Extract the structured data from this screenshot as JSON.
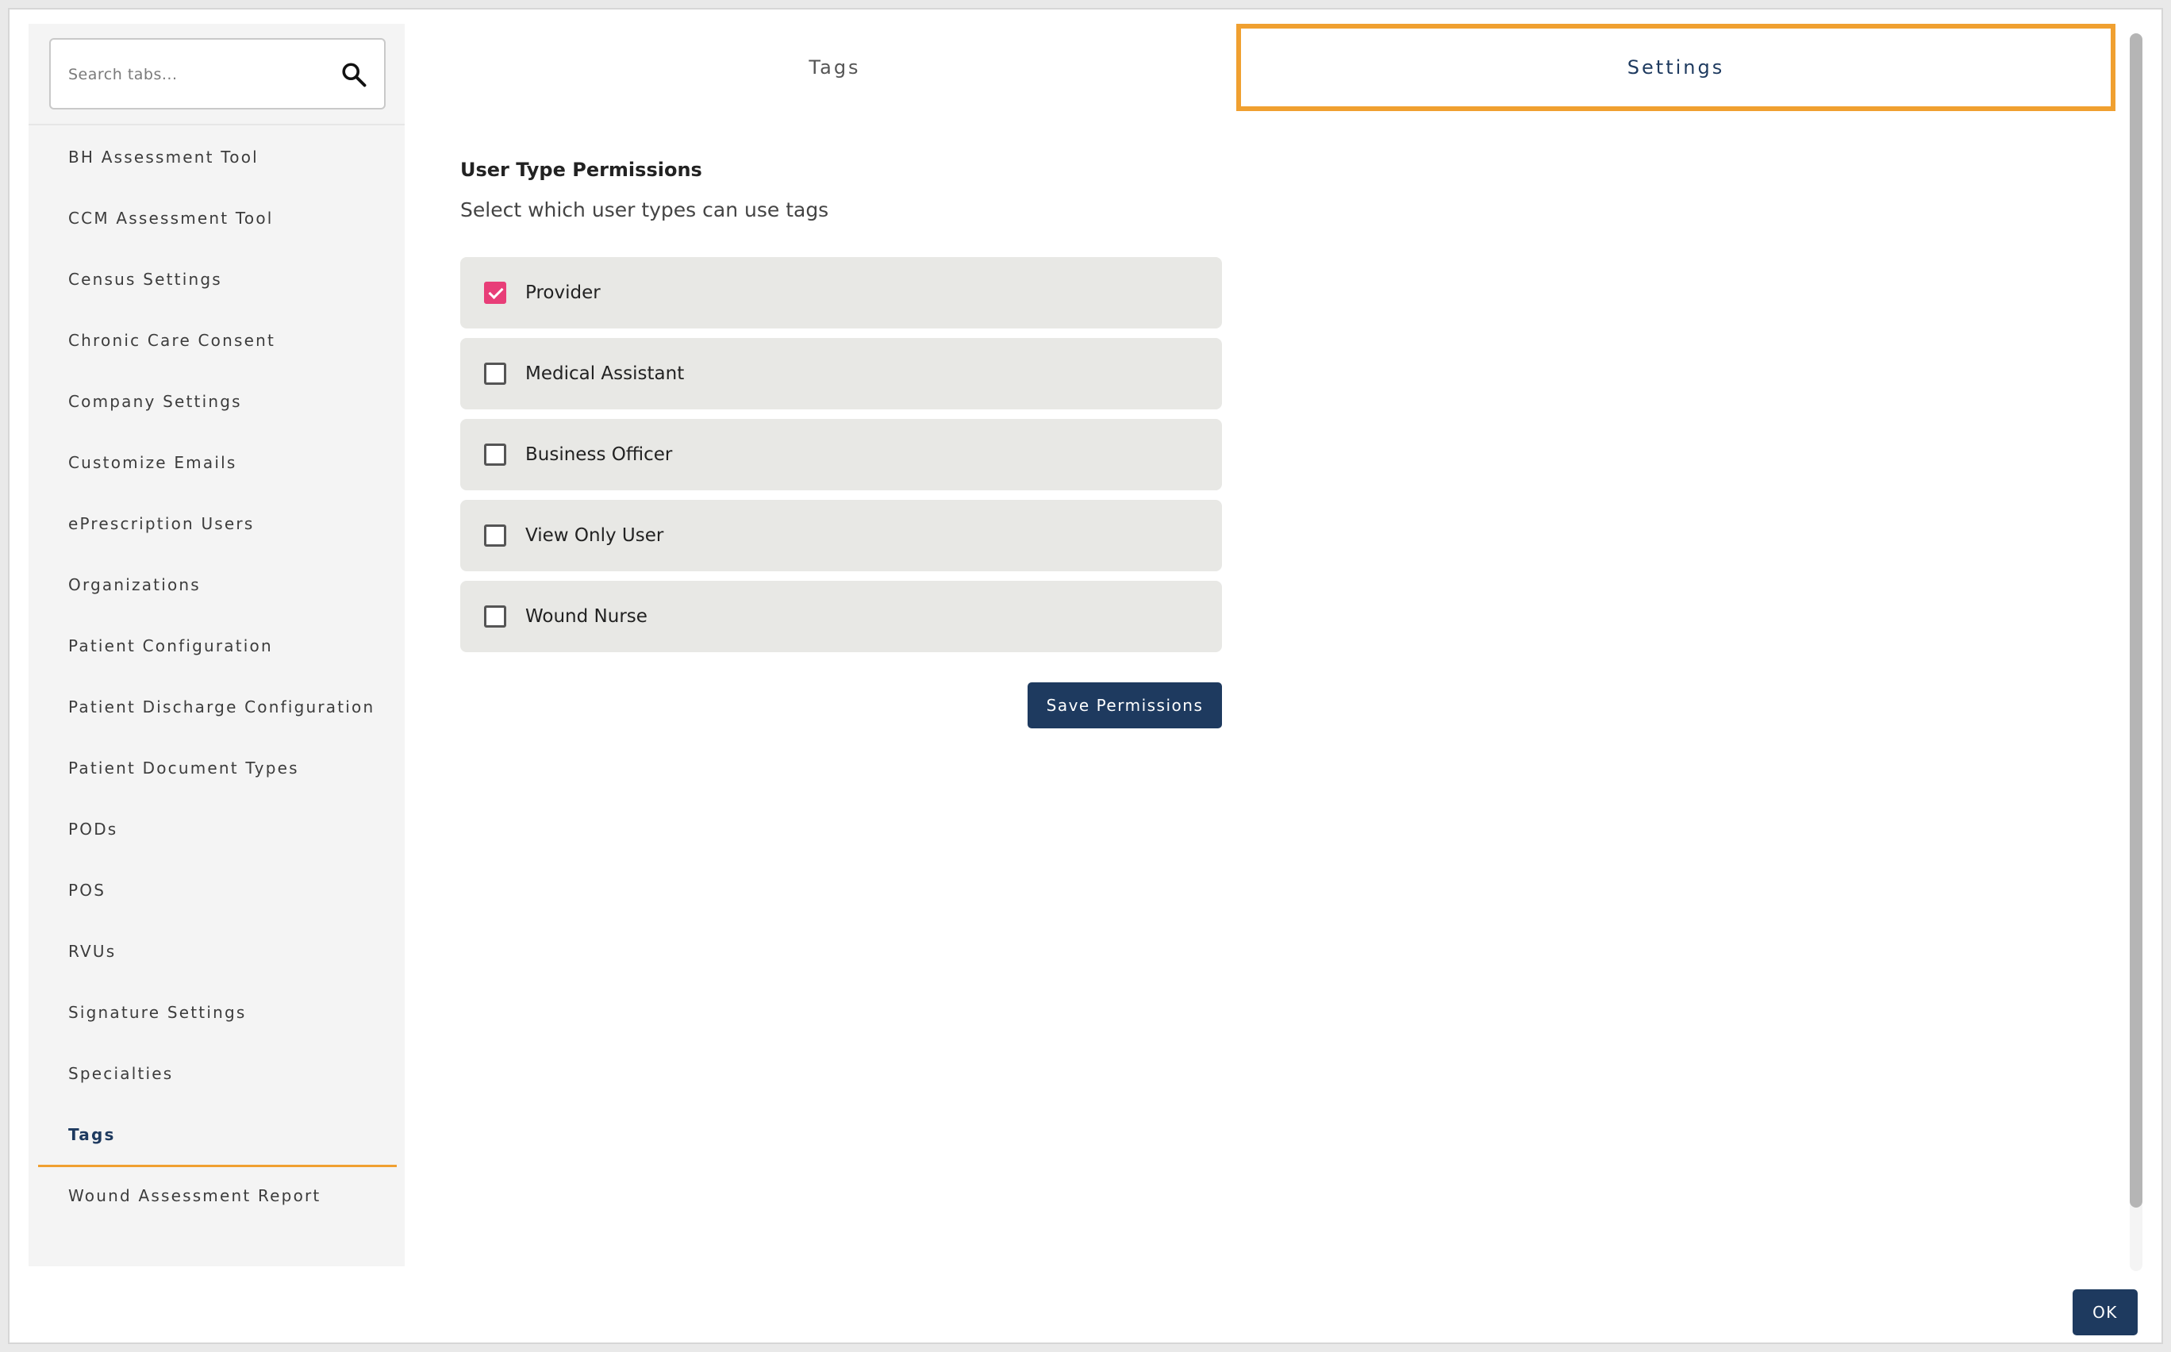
{
  "search": {
    "placeholder": "Search tabs..."
  },
  "sidebar": {
    "items": [
      {
        "label": "BH Assessment Tool",
        "active": false
      },
      {
        "label": "CCM Assessment Tool",
        "active": false
      },
      {
        "label": "Census Settings",
        "active": false
      },
      {
        "label": "Chronic Care Consent",
        "active": false
      },
      {
        "label": "Company Settings",
        "active": false
      },
      {
        "label": "Customize Emails",
        "active": false
      },
      {
        "label": "ePrescription Users",
        "active": false
      },
      {
        "label": "Organizations",
        "active": false
      },
      {
        "label": "Patient Configuration",
        "active": false
      },
      {
        "label": "Patient Discharge Configuration",
        "active": false
      },
      {
        "label": "Patient Document Types",
        "active": false
      },
      {
        "label": "PODs",
        "active": false
      },
      {
        "label": "POS",
        "active": false
      },
      {
        "label": "RVUs",
        "active": false
      },
      {
        "label": "Signature Settings",
        "active": false
      },
      {
        "label": "Specialties",
        "active": false
      },
      {
        "label": "Tags",
        "active": true
      },
      {
        "label": "Wound Assessment Report",
        "active": false
      }
    ]
  },
  "tabs": [
    {
      "label": "Tags",
      "selected": false
    },
    {
      "label": "Settings",
      "selected": true
    }
  ],
  "main": {
    "section_title": "User Type Permissions",
    "section_subtitle": "Select which user types can use tags",
    "permissions": [
      {
        "label": "Provider",
        "checked": true
      },
      {
        "label": "Medical Assistant",
        "checked": false
      },
      {
        "label": "Business Officer",
        "checked": false
      },
      {
        "label": "View Only User",
        "checked": false
      },
      {
        "label": "Wound Nurse",
        "checked": false
      }
    ],
    "save_label": "Save Permissions"
  },
  "footer": {
    "ok_label": "OK"
  },
  "colors": {
    "accent": "#f0a030",
    "primary": "#1e3a5f",
    "checkbox_checked": "#e83e78"
  }
}
